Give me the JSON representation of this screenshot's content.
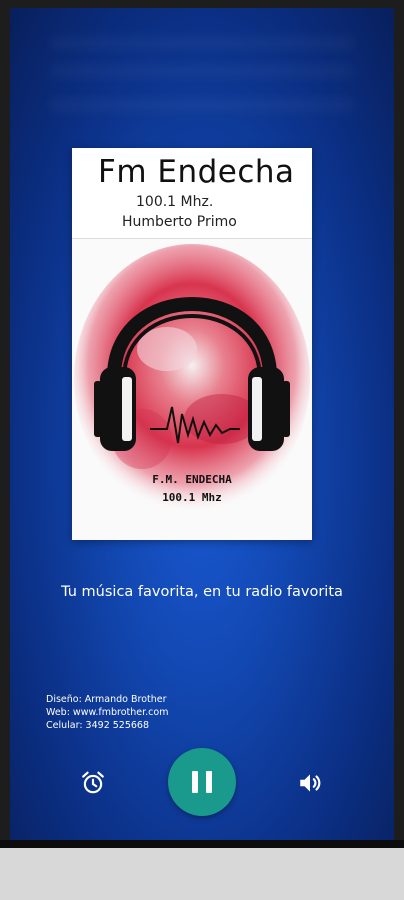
{
  "station": {
    "title": "Fm Endecha",
    "frequency": "100.1 Mhz.",
    "city": "Humberto Primo",
    "art_name": "F.M. ENDECHA",
    "art_frequency": "100.1 Mhz"
  },
  "slogan": "Tu música favorita, en tu radio favorita",
  "credits": {
    "design": "Diseño: Armando Brother",
    "web": "Web: www.fmbrother.com",
    "cell": "Celular: 3492 525668"
  },
  "controls": {
    "alarm_icon": "alarm-clock-icon",
    "play_state": "playing",
    "play_icon": "pause-icon",
    "volume_icon": "volume-icon",
    "accent": "#1a9a8c"
  },
  "colors": {
    "background": "#1247b0",
    "text": "#ffffff"
  }
}
